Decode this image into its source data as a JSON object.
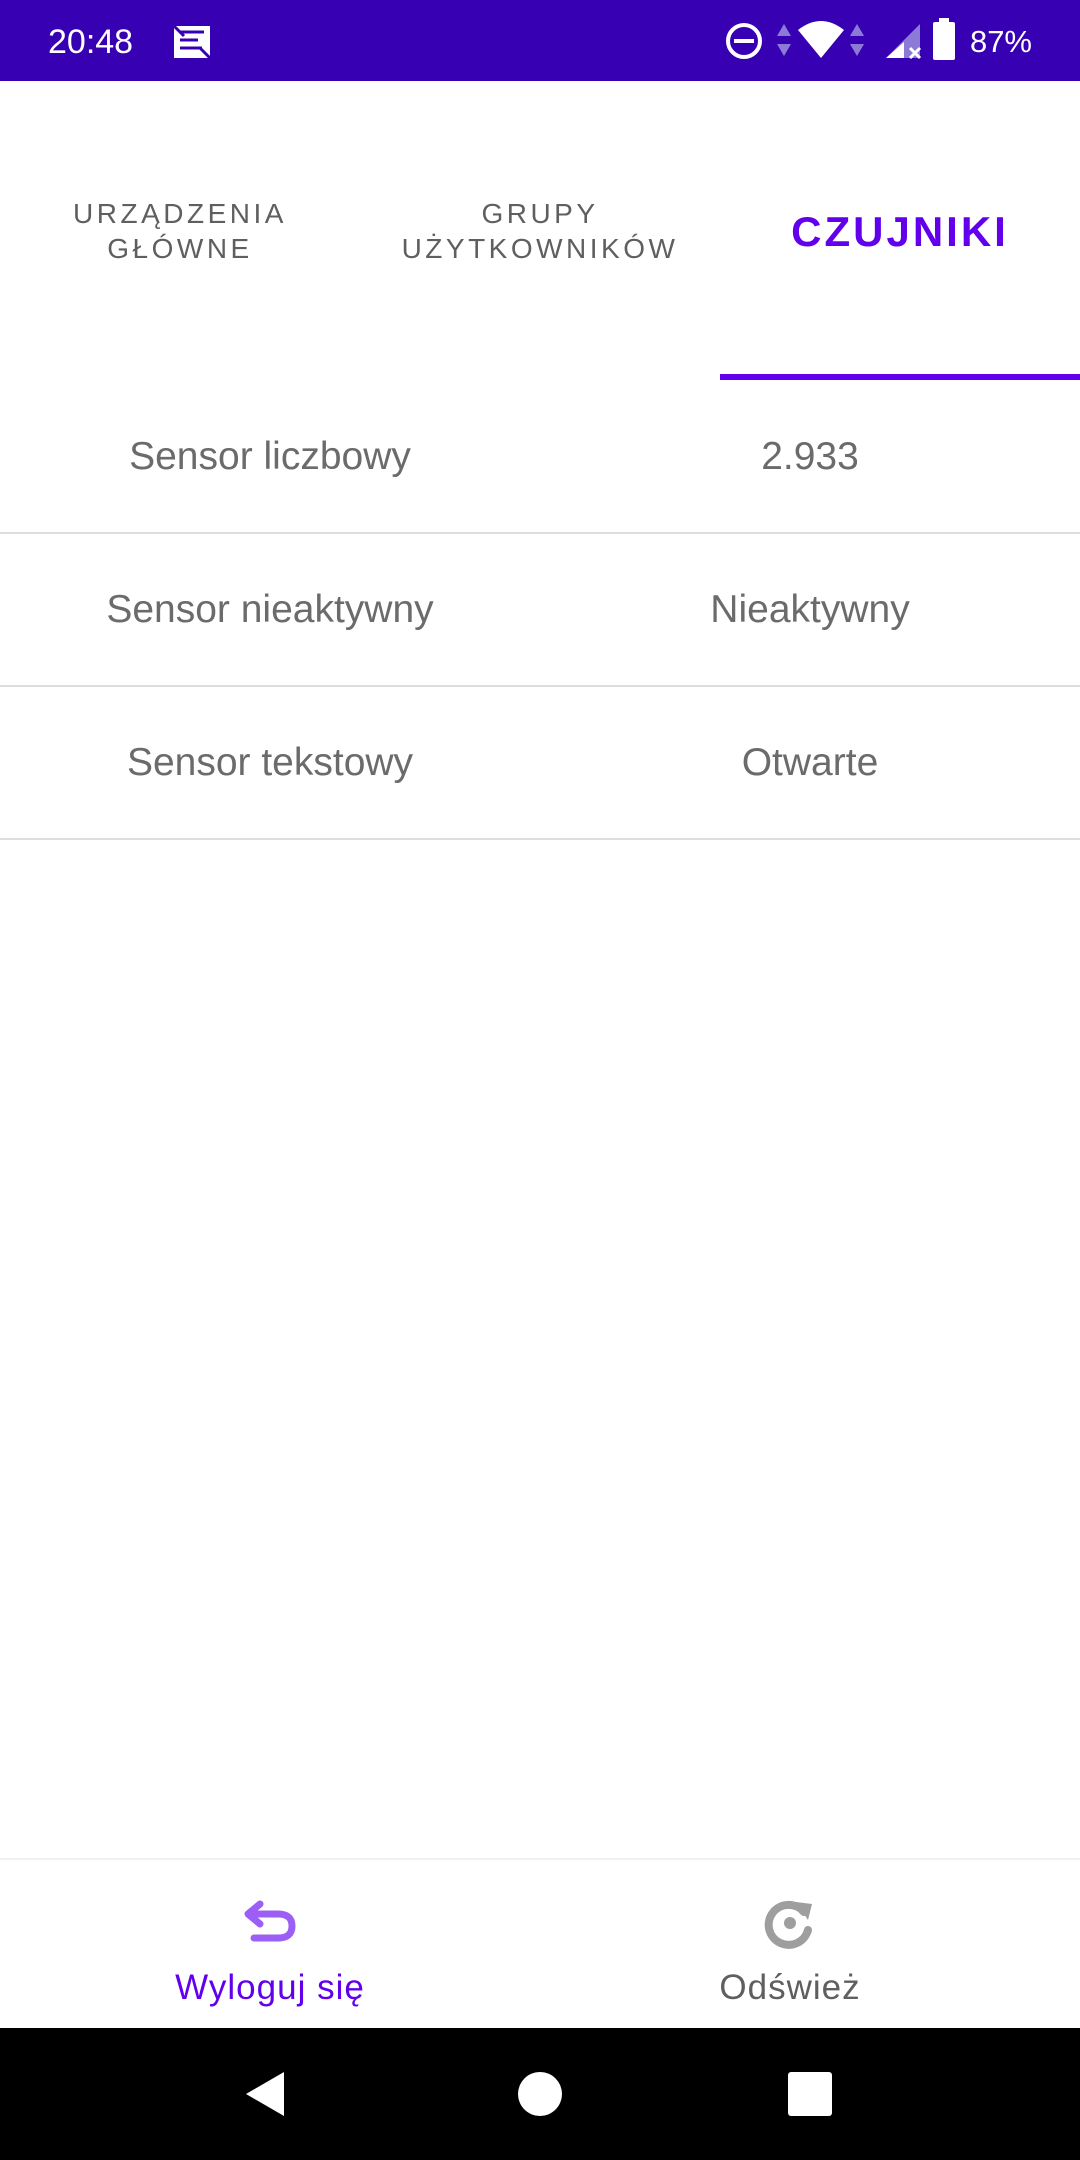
{
  "status_bar": {
    "time": "20:48",
    "battery": "87%",
    "icons": [
      "notification-app-icon",
      "do-not-disturb-icon",
      "wifi-icon",
      "signal-icon",
      "battery-icon"
    ]
  },
  "tabs": [
    {
      "label": "URZĄDZENIA\nGŁÓWNE",
      "active": false
    },
    {
      "label": "GRUPY\nUŻYTKOWNIKÓW",
      "active": false
    },
    {
      "label": "CZUJNIKI",
      "active": true
    }
  ],
  "sensors": [
    {
      "name": "Sensor liczbowy",
      "value": "2.933"
    },
    {
      "name": "Sensor nieaktywny",
      "value": "Nieaktywny"
    },
    {
      "name": "Sensor tekstowy",
      "value": "Otwarte"
    }
  ],
  "bottom_nav": {
    "logout": {
      "label": "Wyloguj się",
      "icon": "undo-arrow-icon"
    },
    "refresh": {
      "label": "Odśwież",
      "icon": "refresh-icon"
    }
  },
  "colors": {
    "status_bar": "#3700b3",
    "accent": "#6200ee",
    "text_secondary": "#6b6b6b",
    "divider": "#dddddd"
  }
}
